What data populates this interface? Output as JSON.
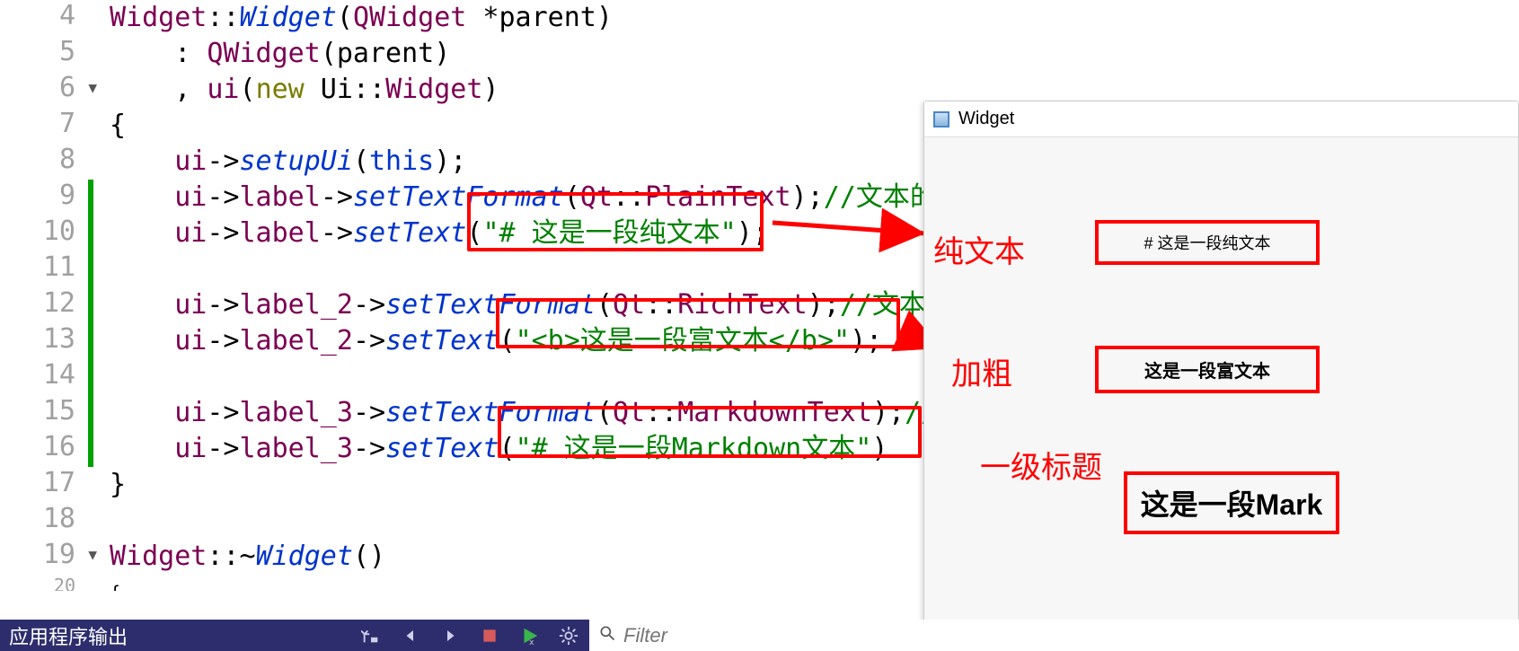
{
  "lines": {
    "l4": {
      "num": "4"
    },
    "l5": {
      "num": "5"
    },
    "l6": {
      "num": "6"
    },
    "l7": {
      "num": "7"
    },
    "l8": {
      "num": "8"
    },
    "l9": {
      "num": "9"
    },
    "l10": {
      "num": "10"
    },
    "l11": {
      "num": "11"
    },
    "l12": {
      "num": "12"
    },
    "l13": {
      "num": "13"
    },
    "l14": {
      "num": "14"
    },
    "l15": {
      "num": "15"
    },
    "l16": {
      "num": "16"
    },
    "l17": {
      "num": "17"
    },
    "l18": {
      "num": "18"
    },
    "l19": {
      "num": "19"
    },
    "l20": {
      "num": "20"
    }
  },
  "code": {
    "l4": {
      "a": "Widget",
      "b": "::",
      "c": "Widget",
      "d": "(",
      "e": "QWidget",
      "f": " *parent)"
    },
    "l5": {
      "a": "    : ",
      "b": "QWidget",
      "c": "(parent)"
    },
    "l6": {
      "a": "    , ",
      "b": "ui",
      "c": "(",
      "d": "new",
      "e": " Ui::",
      "f": "Widget",
      "g": ")"
    },
    "l7": {
      "a": "{"
    },
    "l8": {
      "a": "    ",
      "b": "ui",
      "c": "->",
      "d": "setupUi",
      "e": "(",
      "f": "this",
      "g": ");"
    },
    "l9": {
      "a": "    ",
      "b": "ui",
      "c": "->",
      "d": "label",
      "e": "->",
      "f": "setTextFormat",
      "g": "(",
      "h": "Qt",
      "i": "::",
      "j": "PlainText",
      "k": ");",
      "l": "//文本的"
    },
    "l10": {
      "a": "    ",
      "b": "ui",
      "c": "->",
      "d": "label",
      "e": "->",
      "f": "setText",
      "g": "(",
      "h": "\"# 这是一段纯文本\"",
      "i": ");"
    },
    "l12": {
      "a": "    ",
      "b": "ui",
      "c": "->",
      "d": "label_2",
      "e": "->",
      "f": "setTextFormat",
      "g": "(",
      "h": "Qt",
      "i": "::",
      "j": "RichText",
      "k": ");",
      "l": "//文本"
    },
    "l13": {
      "a": "    ",
      "b": "ui",
      "c": "->",
      "d": "label_2",
      "e": "->",
      "f": "setText",
      "g": "(",
      "h": "\"<b>这是一段富文本</b>\"",
      "i": ");"
    },
    "l15": {
      "a": "    ",
      "b": "ui",
      "c": "->",
      "d": "label_3",
      "e": "->",
      "f": "setTextFormat",
      "g": "(",
      "h": "Qt",
      "i": "::",
      "j": "MarkdownText",
      "k": ");",
      "l": "//"
    },
    "l16": {
      "a": "    ",
      "b": "ui",
      "c": "->",
      "d": "label_3",
      "e": "->",
      "f": "setText",
      "g": "(",
      "h": "\"# 这是一段Markdown文本\"",
      "i": ")"
    },
    "l17": {
      "a": "}"
    },
    "l19": {
      "a": "Widget",
      "b": "::~",
      "c": "Widget",
      "d": "()"
    },
    "l20": {
      "a": "{"
    }
  },
  "bottom": {
    "app_output": "应用程序输出",
    "filter_placeholder": "Filter"
  },
  "widget": {
    "title": "Widget",
    "ann1": "纯文本",
    "ann2": "加粗",
    "ann3": "一级标题",
    "result1": "# 这是一段纯文本",
    "result2": "这是一段富文本",
    "result3": "这是一段Mark"
  }
}
